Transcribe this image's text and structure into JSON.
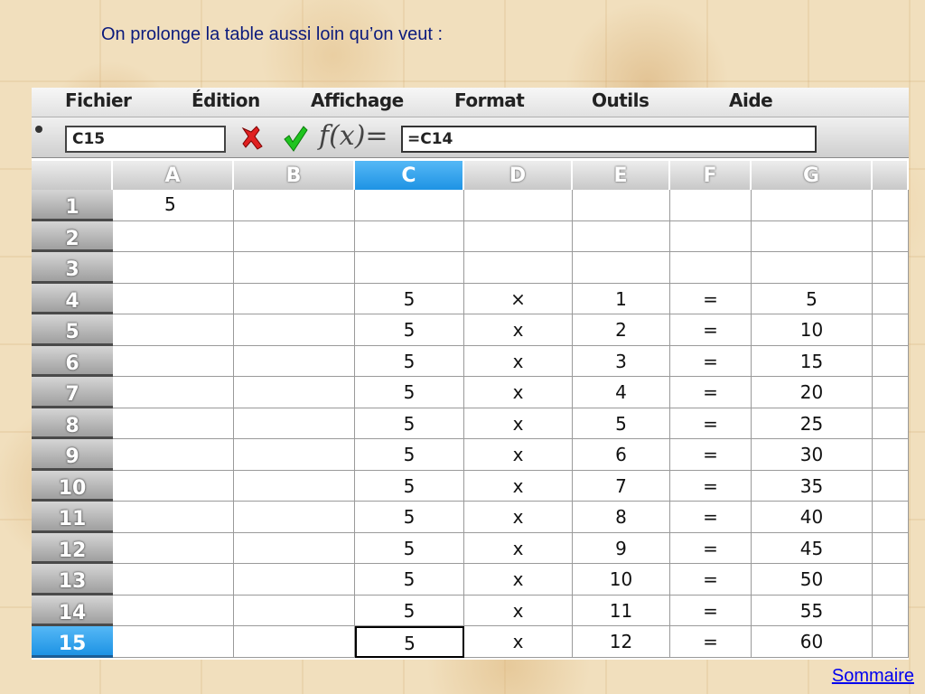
{
  "headline": "On prolonge la table aussi loin qu’on veut :",
  "menu": [
    "Fichier",
    "Édition",
    "Affichage",
    "Format",
    "Outils",
    "Aide"
  ],
  "formula_bar": {
    "cell_ref": "C15",
    "fx_label": "f(x)=",
    "formula": "=C14",
    "cancel_icon": "cancel-x-icon",
    "accept_icon": "accept-check-icon"
  },
  "columns": [
    "A",
    "B",
    "C",
    "D",
    "E",
    "F",
    "G"
  ],
  "selected_column": "C",
  "selected_row": "15",
  "rows": [
    {
      "num": "1",
      "A": "5",
      "C": "",
      "D": "",
      "E": "",
      "F": "",
      "G": ""
    },
    {
      "num": "2",
      "A": "",
      "C": "",
      "D": "",
      "E": "",
      "F": "",
      "G": ""
    },
    {
      "num": "3",
      "A": "",
      "C": "",
      "D": "",
      "E": "",
      "F": "",
      "G": ""
    },
    {
      "num": "4",
      "A": "",
      "C": "5",
      "D": "×",
      "E": "1",
      "F": "=",
      "G": "5"
    },
    {
      "num": "5",
      "A": "",
      "C": "5",
      "D": "x",
      "E": "2",
      "F": "=",
      "G": "10"
    },
    {
      "num": "6",
      "A": "",
      "C": "5",
      "D": "x",
      "E": "3",
      "F": "=",
      "G": "15"
    },
    {
      "num": "7",
      "A": "",
      "C": "5",
      "D": "x",
      "E": "4",
      "F": "=",
      "G": "20"
    },
    {
      "num": "8",
      "A": "",
      "C": "5",
      "D": "x",
      "E": "5",
      "F": "=",
      "G": "25"
    },
    {
      "num": "9",
      "A": "",
      "C": "5",
      "D": "x",
      "E": "6",
      "F": "=",
      "G": "30"
    },
    {
      "num": "10",
      "A": "",
      "C": "5",
      "D": "x",
      "E": "7",
      "F": "=",
      "G": "35"
    },
    {
      "num": "11",
      "A": "",
      "C": "5",
      "D": "x",
      "E": "8",
      "F": "=",
      "G": "40"
    },
    {
      "num": "12",
      "A": "",
      "C": "5",
      "D": "x",
      "E": "9",
      "F": "=",
      "G": "45"
    },
    {
      "num": "13",
      "A": "",
      "C": "5",
      "D": "x",
      "E": "10",
      "F": "=",
      "G": "50"
    },
    {
      "num": "14",
      "A": "",
      "C": "5",
      "D": "x",
      "E": "11",
      "F": "=",
      "G": "55"
    },
    {
      "num": "15",
      "A": "",
      "C": "5",
      "D": "x",
      "E": "12",
      "F": "=",
      "G": "60"
    }
  ],
  "sommaire": "Sommaire",
  "colors": {
    "selection": "#1e93e4",
    "headline": "#0b1a7c",
    "link": "#0000ee"
  }
}
